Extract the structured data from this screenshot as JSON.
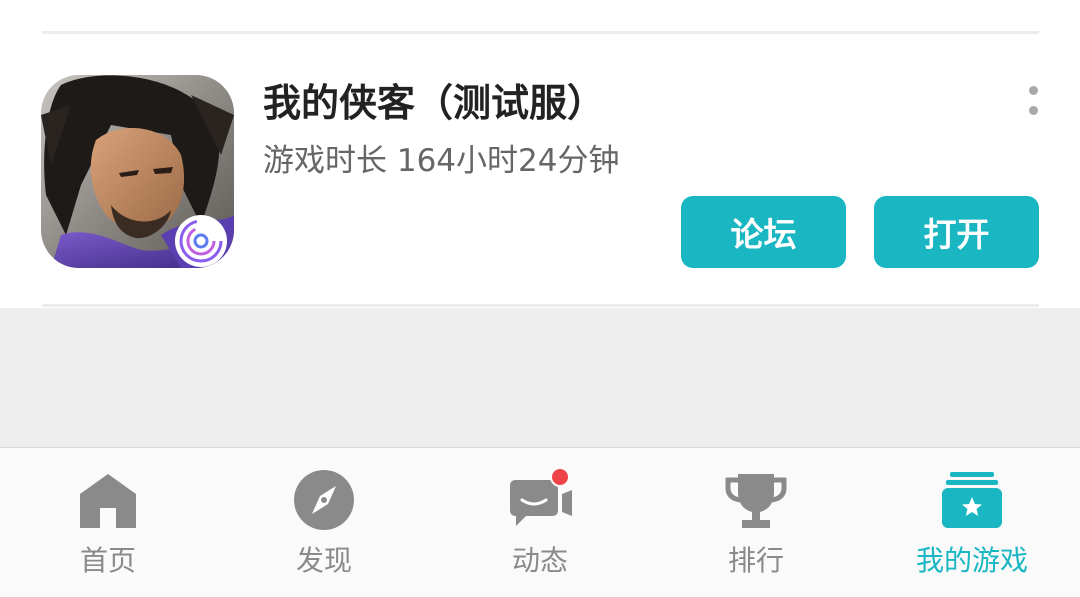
{
  "game": {
    "title": "我的侠客（测试服）",
    "playtime": "游戏时长 164小时24分钟",
    "forum_label": "论坛",
    "open_label": "打开"
  },
  "tabbar": {
    "tabs": [
      {
        "label": "首页",
        "icon": "home-icon",
        "active": false
      },
      {
        "label": "发现",
        "icon": "compass-icon",
        "active": false
      },
      {
        "label": "动态",
        "icon": "chat-bubbles-icon",
        "active": false,
        "badge": true
      },
      {
        "label": "排行",
        "icon": "trophy-icon",
        "active": false
      },
      {
        "label": "我的游戏",
        "icon": "game-library-star-icon",
        "active": true
      }
    ],
    "active_color": "#1ab7c3",
    "inactive_color": "#8a8a8a"
  },
  "colors": {
    "accent": "#1ab7c3",
    "badge": "#f0434a"
  }
}
